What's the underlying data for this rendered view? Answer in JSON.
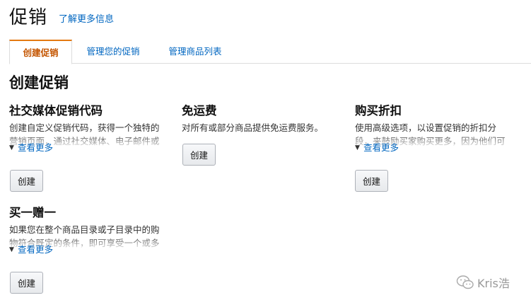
{
  "header": {
    "title": "促销",
    "learn_more": "了解更多信息"
  },
  "tabs": [
    {
      "label": "创建促销",
      "active": true
    },
    {
      "label": "管理您的促销",
      "active": false
    },
    {
      "label": "管理商品列表",
      "active": false
    }
  ],
  "section": {
    "title": "创建促销"
  },
  "cards": [
    {
      "title": "社交媒体促销代码",
      "desc_line1": "创建自定义促销代码，获得一个独特的",
      "desc_line2": "营销页面，通过社交媒体、电子邮件或",
      "see_more": "查看更多",
      "button": "创建"
    },
    {
      "title": "免运费",
      "desc_line1": "对所有或部分商品提供免运费服务。",
      "button": "创建"
    },
    {
      "title": "购买折扣",
      "desc_line1": "使用高级选项，以设置促销的折扣分",
      "desc_line2": "段，来鼓励买家购买更多，因为他们可",
      "see_more": "查看更多",
      "button": "创建"
    },
    {
      "title": "买一赠一",
      "desc_line1": "如果您在整个商品目录或子目录中的购",
      "desc_line2": "物符合既定的条件，即可享受一个或多",
      "see_more": "查看更多",
      "button": "创建"
    }
  ],
  "watermark": {
    "text": "Kris浩",
    "icon": "wechat-icon"
  },
  "colors": {
    "link": "#0066c0",
    "active_tab": "#c45500",
    "tab_accent": "#e47911"
  }
}
